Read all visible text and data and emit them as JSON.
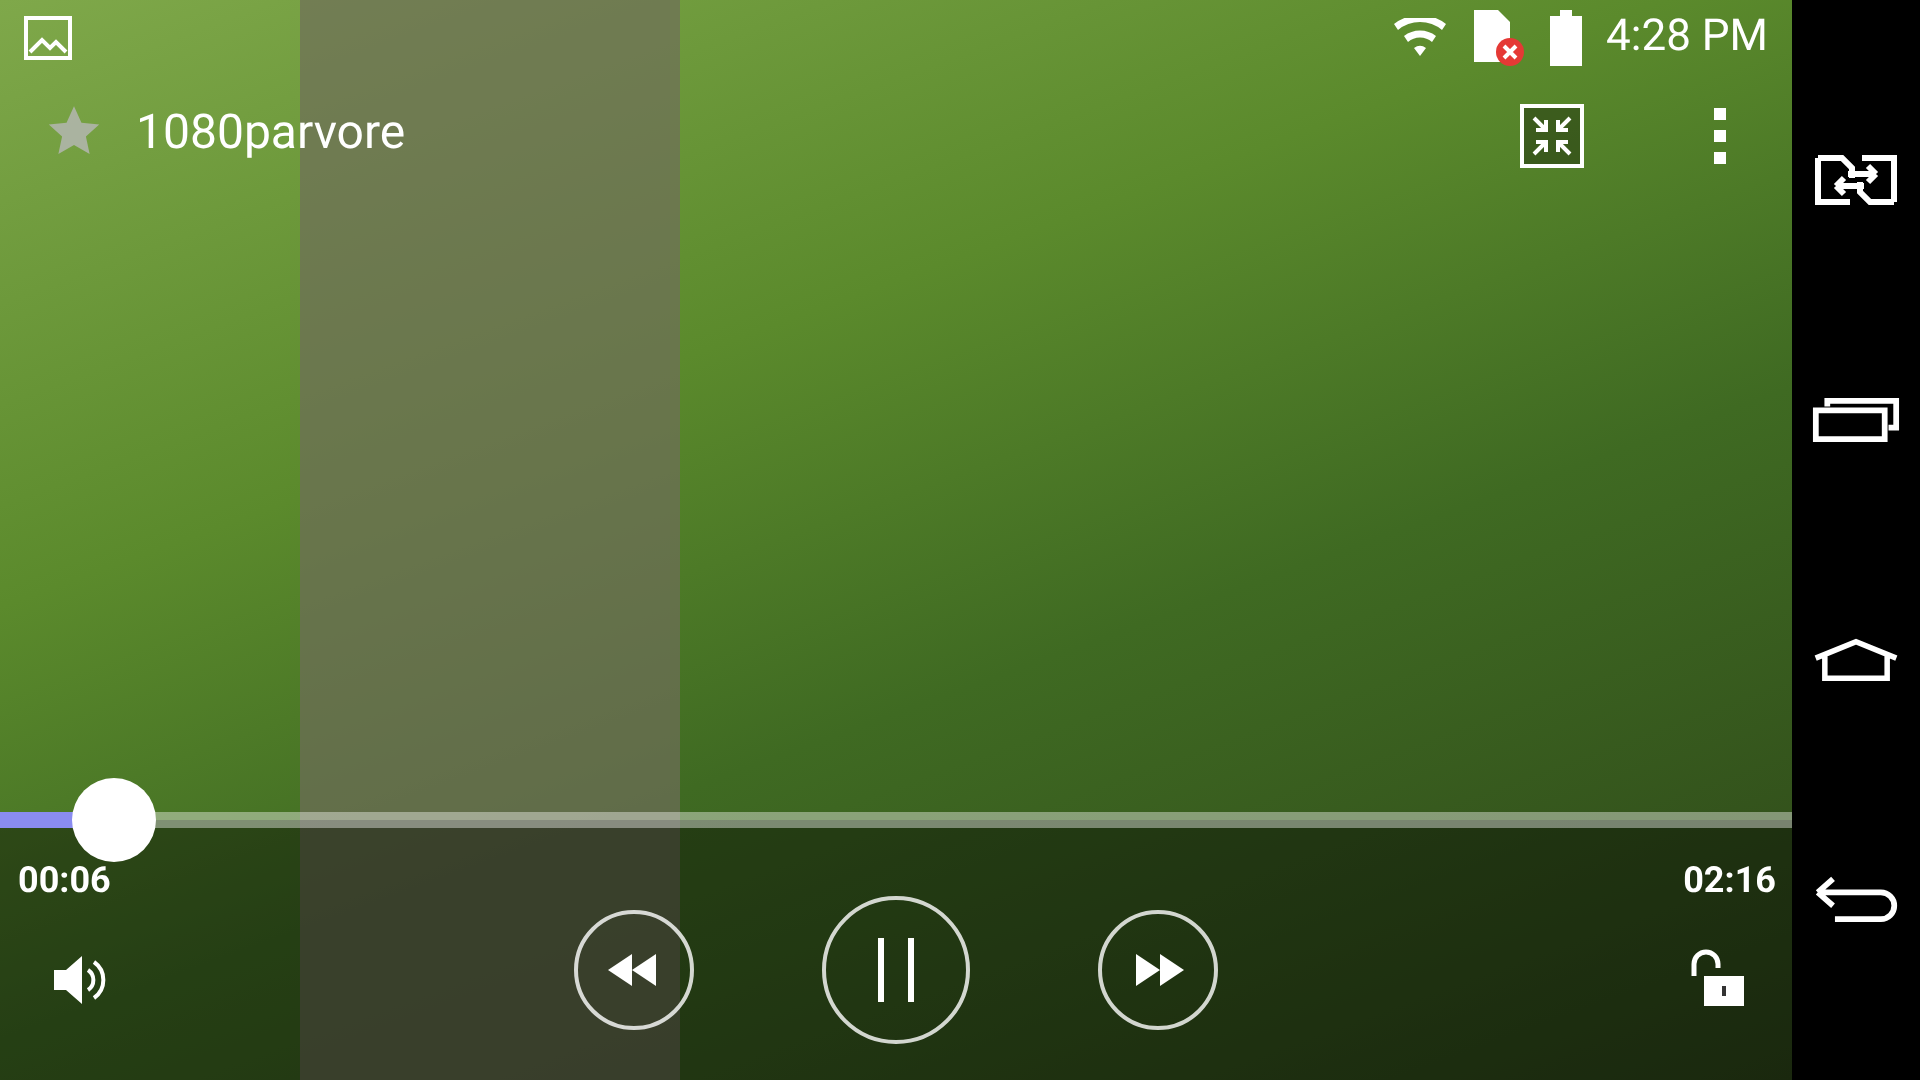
{
  "status_bar": {
    "time": "4:28 PM"
  },
  "video": {
    "title": "1080parvore",
    "favorite": false
  },
  "player": {
    "level": 0.064,
    "elapsed": "00:06",
    "duration": "02:16",
    "playing": true,
    "locked": false
  },
  "nav_bar": {
    "buttons": [
      {
        "kind": "switch"
      },
      {
        "kind": "recents"
      },
      {
        "kind": "home"
      },
      {
        "kind": "back"
      }
    ]
  }
}
